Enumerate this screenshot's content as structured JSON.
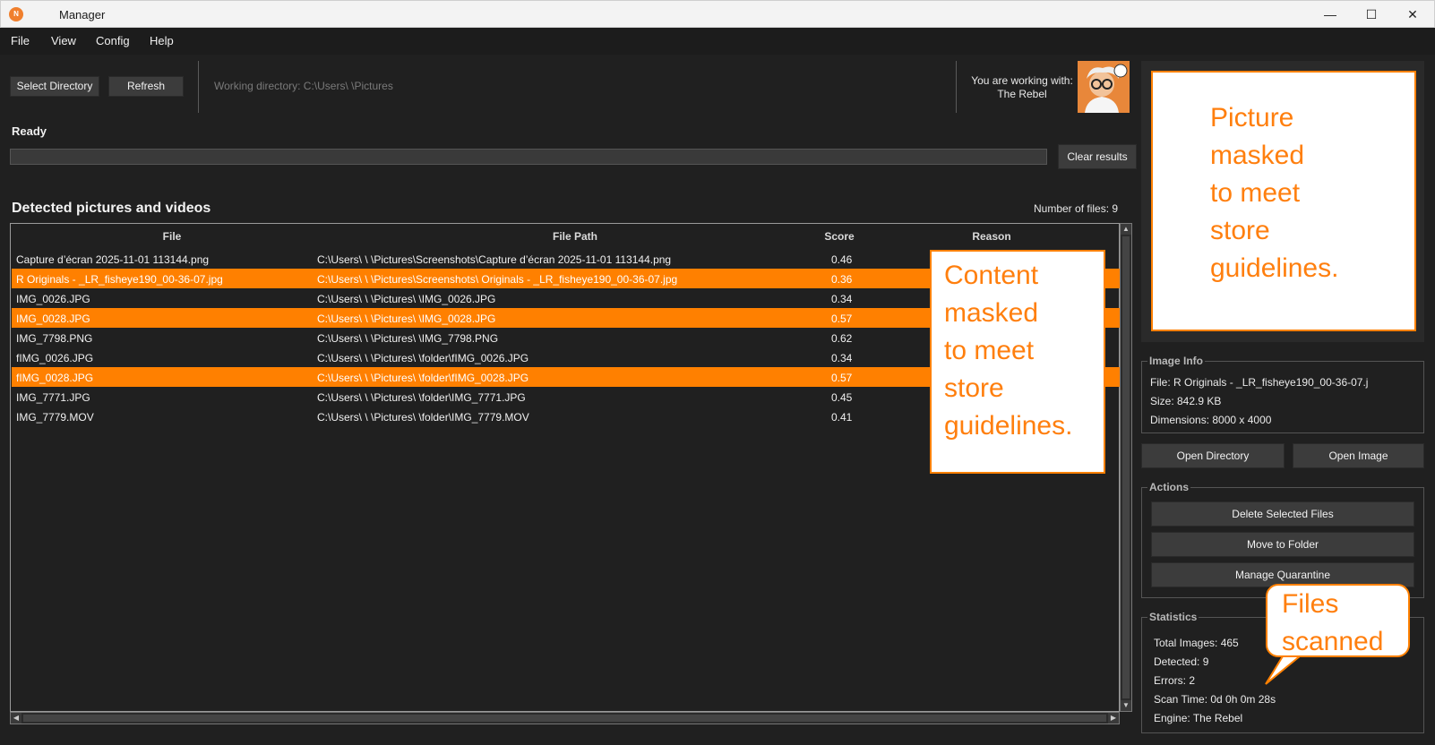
{
  "window": {
    "title": "Manager",
    "app_icon_letter": "N",
    "minimize": "—",
    "maximize": "☐",
    "close": "✕"
  },
  "menu": [
    "File",
    "View",
    "Config",
    "Help"
  ],
  "toolbar": {
    "select_directory": "Select Directory",
    "refresh": "Refresh",
    "working_directory": "Working directory: C:\\Users\\              \\Pictures",
    "user_line1": "You are working with:",
    "user_line2": "The Rebel"
  },
  "status": {
    "text": "Ready",
    "progress": 0,
    "clear_results": "Clear results"
  },
  "results": {
    "title": "Detected pictures and videos",
    "count_label": "Number of files: 9",
    "columns": [
      "File",
      "File Path",
      "Score",
      "Reason"
    ],
    "rows": [
      {
        "file": "Capture d’écran 2025-11-01 113144.png",
        "path": "C:\\Users\\         \\              \\Pictures\\Screenshots\\Capture d’écran 2025-11-01 113144.png",
        "score": "0.46",
        "selected": false
      },
      {
        "file": "R Originals -                          _LR_fisheye190_00-36-07.jpg",
        "path": "C:\\Users\\         \\              \\Pictures\\Screenshots\\          Originals -                          _LR_fisheye190_00-36-07.jpg",
        "score": "0.36",
        "selected": true
      },
      {
        "file": "IMG_0026.JPG",
        "path": "C:\\Users\\         \\              \\Pictures\\               \\IMG_0026.JPG",
        "score": "0.34",
        "selected": false
      },
      {
        "file": "IMG_0028.JPG",
        "path": "C:\\Users\\         \\              \\Pictures\\               \\IMG_0028.JPG",
        "score": "0.57",
        "selected": true
      },
      {
        "file": "IMG_7798.PNG",
        "path": "C:\\Users\\         \\              \\Pictures\\               \\IMG_7798.PNG",
        "score": "0.62",
        "selected": false
      },
      {
        "file": "fIMG_0026.JPG",
        "path": "C:\\Users\\         \\              \\Pictures\\               \\folder\\fIMG_0026.JPG",
        "score": "0.34",
        "selected": false
      },
      {
        "file": "fIMG_0028.JPG",
        "path": "C:\\Users\\         \\              \\Pictures\\               \\folder\\fIMG_0028.JPG",
        "score": "0.57",
        "selected": true
      },
      {
        "file": "IMG_7771.JPG",
        "path": "C:\\Users\\         \\              \\Pictures\\               \\folder\\IMG_7771.JPG",
        "score": "0.45",
        "selected": false
      },
      {
        "file": "IMG_7779.MOV",
        "path": "C:\\Users\\         \\              \\Pictures\\               \\folder\\IMG_7779.MOV",
        "score": "0.41",
        "selected": false
      }
    ],
    "mask_text": [
      "Content",
      "masked",
      "to meet",
      "store",
      "guidelines."
    ]
  },
  "preview": {
    "mask_text": [
      "Picture",
      "masked",
      "to meet",
      "store",
      "guidelines."
    ]
  },
  "image_info": {
    "title": "Image Info",
    "file": "File:    R Originals -                          _LR_fisheye190_00-36-07.j",
    "size": "Size: 842.9 KB",
    "dimensions": "Dimensions: 8000 x 4000"
  },
  "buttons": {
    "open_directory": "Open Directory",
    "open_image": "Open Image"
  },
  "actions": {
    "title": "Actions",
    "delete": "Delete Selected Files",
    "move": "Move to Folder",
    "quarantine": "Manage Quarantine"
  },
  "statistics": {
    "title": "Statistics",
    "total": "Total Images: 465",
    "detected": "Detected: 9",
    "errors": "Errors: 2",
    "scan_time": "Scan Time: 0d 0h 0m 28s",
    "engine": "Engine: The Rebel"
  },
  "callout": {
    "text": [
      "Files",
      "scanned"
    ]
  },
  "colors": {
    "accent": "#ff8000",
    "background": "#202020",
    "button": "#3c3c3c"
  },
  "icons": [
    "app-icon",
    "minimize-icon",
    "maximize-icon",
    "close-icon",
    "avatar"
  ]
}
